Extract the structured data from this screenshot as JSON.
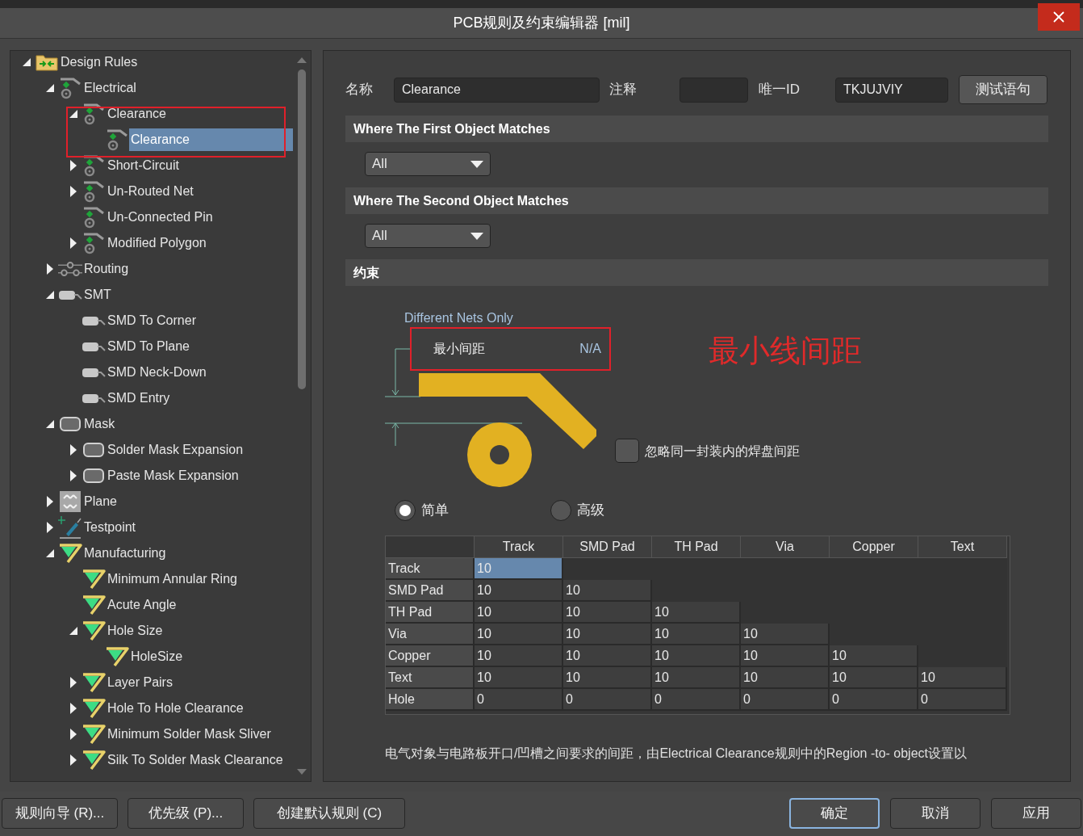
{
  "window": {
    "title": "PCB规则及约束编辑器 [mil]"
  },
  "rules_tree": {
    "label": "Design Rules",
    "kind": "folder",
    "expanded": true,
    "selected": false,
    "children": [
      {
        "label": "Electrical",
        "kind": "electrical",
        "expanded": true,
        "selected": false,
        "children": [
          {
            "label": "Clearance",
            "kind": "electrical",
            "expanded": true,
            "selected": false,
            "children": [
              {
                "label": "Clearance",
                "kind": "electrical",
                "selected": true
              }
            ]
          },
          {
            "label": "Short-Circuit",
            "kind": "electrical",
            "expanded": false,
            "selected": false
          },
          {
            "label": "Un-Routed Net",
            "kind": "electrical",
            "expanded": false,
            "selected": false
          },
          {
            "label": "Un-Connected Pin",
            "kind": "electrical",
            "selected": false
          },
          {
            "label": "Modified Polygon",
            "kind": "electrical",
            "expanded": false,
            "selected": false
          }
        ]
      },
      {
        "label": "Routing",
        "kind": "routing",
        "expanded": false,
        "selected": false
      },
      {
        "label": "SMT",
        "kind": "smt",
        "expanded": true,
        "selected": false,
        "children": [
          {
            "label": "SMD To Corner",
            "kind": "smt",
            "selected": false
          },
          {
            "label": "SMD To Plane",
            "kind": "smt",
            "selected": false
          },
          {
            "label": "SMD Neck-Down",
            "kind": "smt",
            "selected": false
          },
          {
            "label": "SMD Entry",
            "kind": "smt",
            "selected": false
          }
        ]
      },
      {
        "label": "Mask",
        "kind": "mask",
        "expanded": true,
        "selected": false,
        "children": [
          {
            "label": "Solder Mask Expansion",
            "kind": "mask",
            "expanded": false,
            "selected": false
          },
          {
            "label": "Paste Mask Expansion",
            "kind": "mask",
            "expanded": false,
            "selected": false
          }
        ]
      },
      {
        "label": "Plane",
        "kind": "plane",
        "expanded": false,
        "selected": false
      },
      {
        "label": "Testpoint",
        "kind": "testpoint",
        "expanded": false,
        "selected": false
      },
      {
        "label": "Manufacturing",
        "kind": "manufacturing",
        "expanded": true,
        "selected": false,
        "children": [
          {
            "label": "Minimum Annular Ring",
            "kind": "manufacturing",
            "selected": false
          },
          {
            "label": "Acute Angle",
            "kind": "manufacturing",
            "selected": false
          },
          {
            "label": "Hole Size",
            "kind": "manufacturing",
            "expanded": true,
            "selected": false,
            "children": [
              {
                "label": "HoleSize",
                "kind": "manufacturing",
                "selected": false
              }
            ]
          },
          {
            "label": "Layer Pairs",
            "kind": "manufacturing",
            "expanded": false,
            "selected": false
          },
          {
            "label": "Hole To Hole Clearance",
            "kind": "manufacturing",
            "expanded": false,
            "selected": false
          },
          {
            "label": "Minimum Solder Mask Sliver",
            "kind": "manufacturing",
            "expanded": false,
            "selected": false
          },
          {
            "label": "Silk To Solder Mask Clearance",
            "kind": "manufacturing",
            "expanded": false,
            "selected": false
          }
        ]
      }
    ]
  },
  "rule_header": {
    "name_label": "名称",
    "name_value": "Clearance",
    "comment_label": "注释",
    "id_label": "唯一ID",
    "id_value": "TKJUJVIY",
    "test_button": "测试语句"
  },
  "first_object": {
    "title": "Where The First Object Matches",
    "scope": "All"
  },
  "second_object": {
    "title": "Where The Second Object Matches",
    "scope": "All"
  },
  "constraints": {
    "title": "约束",
    "net_scope": "Different Nets Only",
    "min_clearance_label": "最小间距",
    "min_clearance_value": "N/A",
    "annotation": "最小线间距",
    "ignore_pads": {
      "label": "忽略同一封装内的焊盘间距",
      "checked": false
    },
    "modes": [
      {
        "label": "简单",
        "selected": true
      },
      {
        "label": "高级",
        "selected": false
      }
    ],
    "table": {
      "columns": [
        "Track",
        "SMD Pad",
        "TH Pad",
        "Via",
        "Copper",
        "Text"
      ],
      "rows": [
        {
          "label": "Track",
          "cells": [
            {
              "value": "10",
              "selected": true
            }
          ]
        },
        {
          "label": "SMD Pad",
          "cells": [
            {
              "value": "10",
              "selected": false
            },
            {
              "value": "10",
              "selected": false
            }
          ]
        },
        {
          "label": "TH Pad",
          "cells": [
            {
              "value": "10",
              "selected": false
            },
            {
              "value": "10",
              "selected": false
            },
            {
              "value": "10",
              "selected": false
            }
          ]
        },
        {
          "label": "Via",
          "cells": [
            {
              "value": "10",
              "selected": false
            },
            {
              "value": "10",
              "selected": false
            },
            {
              "value": "10",
              "selected": false
            },
            {
              "value": "10",
              "selected": false
            }
          ]
        },
        {
          "label": "Copper",
          "cells": [
            {
              "value": "10",
              "selected": false
            },
            {
              "value": "10",
              "selected": false
            },
            {
              "value": "10",
              "selected": false
            },
            {
              "value": "10",
              "selected": false
            },
            {
              "value": "10",
              "selected": false
            }
          ]
        },
        {
          "label": "Text",
          "cells": [
            {
              "value": "10",
              "selected": false
            },
            {
              "value": "10",
              "selected": false
            },
            {
              "value": "10",
              "selected": false
            },
            {
              "value": "10",
              "selected": false
            },
            {
              "value": "10",
              "selected": false
            },
            {
              "value": "10",
              "selected": false
            }
          ]
        },
        {
          "label": "Hole",
          "cells": [
            {
              "value": "0",
              "selected": false
            },
            {
              "value": "0",
              "selected": false
            },
            {
              "value": "0",
              "selected": false
            },
            {
              "value": "0",
              "selected": false
            },
            {
              "value": "0",
              "selected": false
            },
            {
              "value": "0",
              "selected": false
            }
          ]
        }
      ]
    },
    "description": "电气对象与电路板开口/凹槽之间要求的间距，由Electrical Clearance规则中的Region -to- object设置以"
  },
  "footer_left_buttons": [
    {
      "label": "规则向导 (R)...",
      "focused": false
    },
    {
      "label": "优先级 (P)...",
      "focused": false
    },
    {
      "label": "创建默认规则 (C)",
      "focused": false
    }
  ],
  "footer_right_buttons": [
    {
      "label": "确定",
      "focused": true
    },
    {
      "label": "取消",
      "focused": false
    },
    {
      "label": "应用",
      "focused": false
    }
  ]
}
